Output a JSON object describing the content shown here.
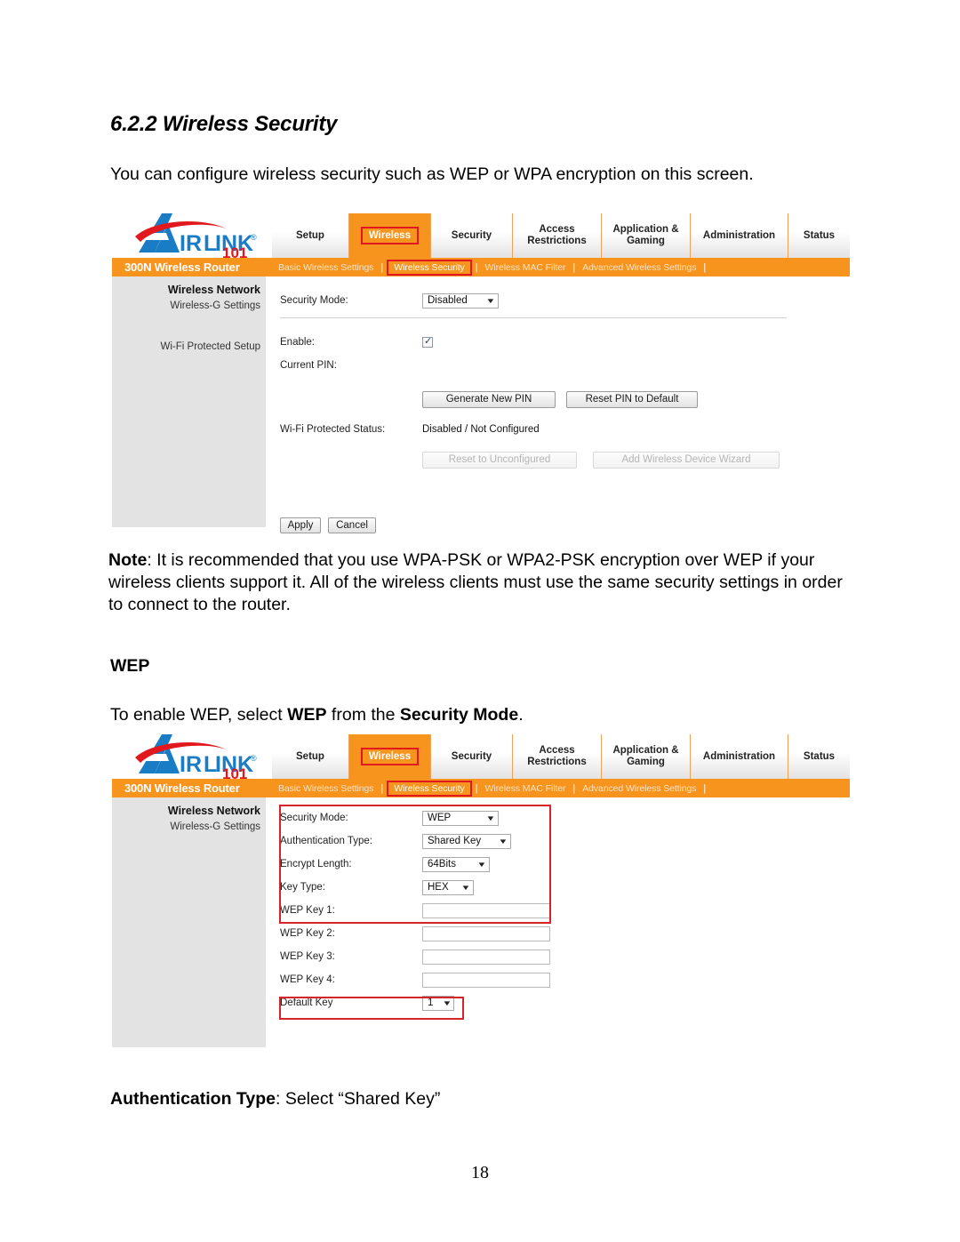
{
  "document": {
    "heading": "6.2.2 Wireless Security",
    "intro": "You can configure wireless security such as WEP or WPA encryption on this screen.",
    "note_label": "Note",
    "note_body": ": It is recommended that you use WPA-PSK or WPA2-PSK encryption over WEP if your wireless clients support it.  All of the wireless clients must use the same security settings in order to connect to the router.",
    "wep_heading": "WEP",
    "wep_instruction_pre": "To enable WEP, select ",
    "wep_instruction_bold1": "WEP",
    "wep_instruction_mid": " from the ",
    "wep_instruction_bold2": "Security Mode",
    "wep_instruction_end": ".",
    "auth_label": "Authentication Type",
    "auth_body": ": Select “Shared Key”",
    "page_number": "18"
  },
  "colors": {
    "brand_orange": "#f7941e",
    "highlight_red": "#d9232a",
    "logo_blue": "#1a7cc4",
    "logo_red": "#e1181d",
    "sidebar_gray": "#e4e3e3"
  },
  "router_ui": {
    "logo": {
      "wordmark": "AIRLINK",
      "registered": "®",
      "number": "101"
    },
    "device_name": "300N Wireless Router",
    "main_tabs": [
      {
        "label": "Setup",
        "active": false
      },
      {
        "label": "Wireless",
        "active": true
      },
      {
        "label": "Security",
        "active": false
      },
      {
        "label": "Access\nRestrictions",
        "active": false
      },
      {
        "label": "Application &\nGaming",
        "active": false
      },
      {
        "label": "Administration",
        "active": false
      },
      {
        "label": "Status",
        "active": false
      }
    ],
    "sub_tabs": [
      {
        "label": "Basic Wireless Settings",
        "active": false
      },
      {
        "label": "Wireless Security",
        "active": true
      },
      {
        "label": "Wireless MAC Filter",
        "active": false
      },
      {
        "label": "Advanced Wireless Settings",
        "active": false
      }
    ],
    "sidebar": {
      "title": "Wireless Network",
      "item1": "Wireless-G Settings",
      "item2": "Wi-Fi Protected Setup"
    }
  },
  "screenshot_disabled": {
    "security_mode_label": "Security Mode:",
    "security_mode_value": "Disabled",
    "enable_label": "Enable:",
    "enable_checked": true,
    "current_pin_label": "Current PIN:",
    "current_pin_value": "",
    "generate_pin_button": "Generate New PIN",
    "reset_pin_button": "Reset PIN to Default",
    "wps_status_label": "Wi-Fi Protected Status:",
    "wps_status_value": "Disabled / Not Configured",
    "reset_unconfigured_button": "Reset to Unconfigured",
    "add_device_wizard_button": "Add Wireless Device Wizard",
    "apply_button": "Apply",
    "cancel_button": "Cancel"
  },
  "screenshot_wep": {
    "rows": [
      {
        "label": "Security Mode:",
        "type": "select",
        "value": "WEP",
        "width": "w-wep"
      },
      {
        "label": "Authentication Type:",
        "type": "select",
        "value": "Shared Key",
        "width": "w-shared"
      },
      {
        "label": "Encrypt Length:",
        "type": "select",
        "value": "64Bits",
        "width": "w-bits"
      },
      {
        "label": "Key Type:",
        "type": "select",
        "value": "HEX",
        "width": "w-hex"
      },
      {
        "label": "WEP Key 1:",
        "type": "text",
        "value": ""
      },
      {
        "label": "WEP Key 2:",
        "type": "text",
        "value": ""
      },
      {
        "label": "WEP Key 3:",
        "type": "text",
        "value": ""
      },
      {
        "label": "WEP Key 4:",
        "type": "text",
        "value": ""
      },
      {
        "label": "Default Key",
        "type": "select",
        "value": "1",
        "width": "w-num"
      }
    ]
  }
}
